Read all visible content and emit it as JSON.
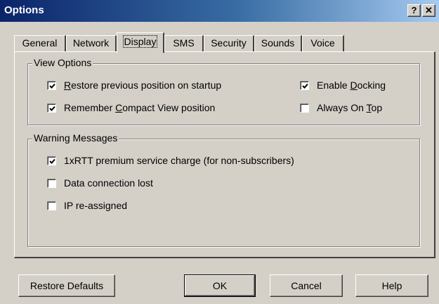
{
  "window": {
    "title": "Options",
    "help_glyph": "?",
    "close_glyph": "✕"
  },
  "tabs": [
    {
      "label": "General",
      "active": false
    },
    {
      "label": "Network",
      "active": false
    },
    {
      "label": "Display",
      "active": true
    },
    {
      "label": "SMS",
      "active": false
    },
    {
      "label": "Security",
      "active": false
    },
    {
      "label": "Sounds",
      "active": false
    },
    {
      "label": "Voice",
      "active": false
    }
  ],
  "view_options": {
    "title": "View Options",
    "restore_position": {
      "mnemonic": "R",
      "rest": "estore previous position on startup",
      "checked": true
    },
    "remember_compact": {
      "before": "Remember ",
      "mnemonic": "C",
      "rest": "ompact View position",
      "checked": true
    },
    "enable_docking": {
      "before": "Enable ",
      "mnemonic": "D",
      "rest": "ocking",
      "checked": true
    },
    "always_on_top": {
      "before": "Always On ",
      "mnemonic": "T",
      "rest": "op",
      "checked": false
    }
  },
  "warning_messages": {
    "title": "Warning Messages",
    "items": [
      {
        "label": "1xRTT premium service charge (for non-subscribers)",
        "checked": true
      },
      {
        "label": "Data connection lost",
        "checked": false
      },
      {
        "label": "IP re-assigned",
        "checked": false
      }
    ]
  },
  "buttons": {
    "restore_defaults": "Restore Defaults",
    "ok": "OK",
    "cancel": "Cancel",
    "help": "Help"
  }
}
